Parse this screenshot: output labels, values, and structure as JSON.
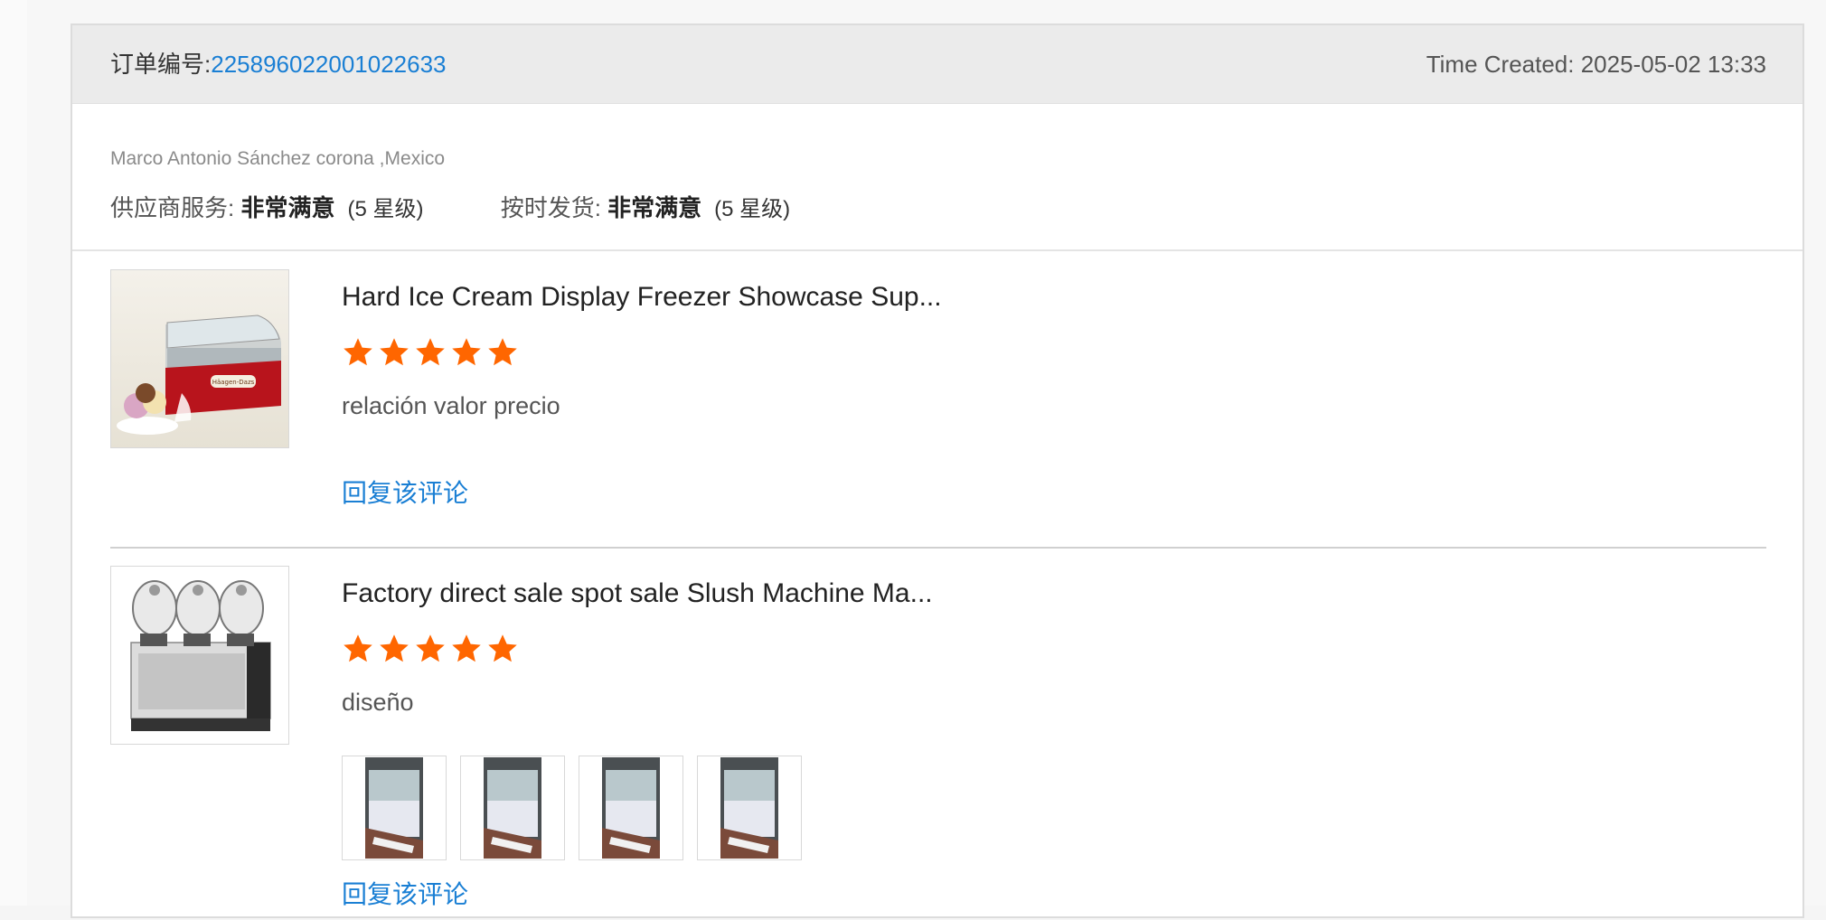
{
  "order": {
    "label": "订单编号:",
    "number": "225896022001022633",
    "time_created": "Time Created: 2025-05-02 13:33"
  },
  "buyer": {
    "name": "Marco Antonio Sánchez corona ,Mexico"
  },
  "ratings": {
    "supplier_service": {
      "label": "供应商服务: ",
      "value": "非常满意",
      "stars": "(5 星级)"
    },
    "on_time_delivery": {
      "label": "按时发货: ",
      "value": "非常满意",
      "stars": "(5 星级)"
    }
  },
  "products": [
    {
      "title": "Hard Ice Cream Display Freezer Showcase Sup...",
      "rating": 5,
      "comment": "relación valor precio",
      "reply_label": "回复该评论",
      "thumb_icon": "ice-cream-display-freezer-image",
      "brand_text": "Häagen-Dazs"
    },
    {
      "title": "Factory direct sale spot sale Slush Machine Ma...",
      "rating": 5,
      "comment": "diseño",
      "reply_label": "回复该评论",
      "thumb_icon": "slush-machine-image",
      "photo_count": 4
    }
  ],
  "colors": {
    "accent_link": "#1a7fd4",
    "star": "#ff6600",
    "header_bg": "#ebebeb"
  }
}
